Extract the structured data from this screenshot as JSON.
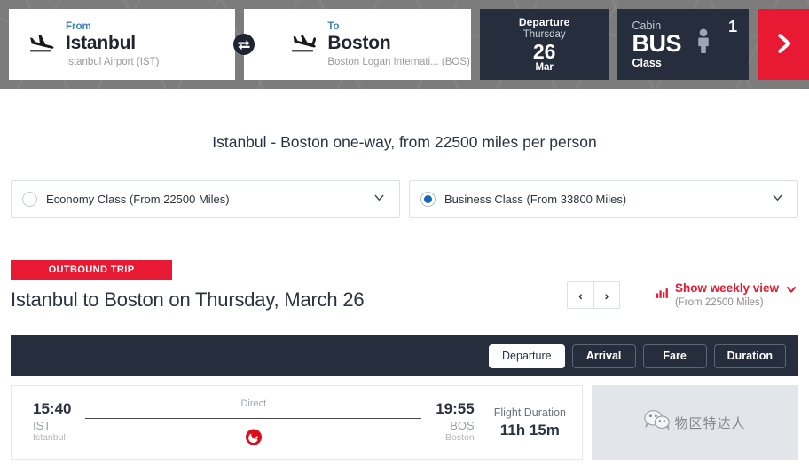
{
  "header": {
    "from": {
      "label": "From",
      "city": "Istanbul",
      "airport": "Istanbul Airport (IST)",
      "icon": "plane-departure-icon"
    },
    "to": {
      "label": "To",
      "city": "Boston",
      "airport": "Boston Logan Internati... (BOS)",
      "icon": "plane-arrival-icon"
    },
    "swap_icon": "swap-arrows-icon",
    "departure": {
      "title": "Departure",
      "weekday": "Thursday",
      "day": "26",
      "month": "Mar"
    },
    "cabin": {
      "label": "Cabin",
      "value": "BUS",
      "sub": "Class",
      "passenger_count": "1",
      "passenger_icon": "person-icon"
    },
    "go_button": {
      "icon": "chevron-right-icon",
      "color": "#e81932"
    }
  },
  "headline": "Istanbul - Boston one-way, from 22500 miles per person",
  "class_options": [
    {
      "label": "Economy Class (From 22500 Miles)",
      "selected": false,
      "chevron": "chevron-down-icon"
    },
    {
      "label": "Business Class (From 33800 Miles)",
      "selected": true,
      "chevron": "chevron-down-icon"
    }
  ],
  "trip": {
    "badge": "OUTBOUND TRIP",
    "title": "Istanbul to Boston on Thursday, March 26",
    "prev_label": "‹",
    "next_label": "›",
    "weekly_icon": "bar-chart-icon",
    "weekly_main": "Show weekly view",
    "weekly_sub": "(From 22500 Miles)",
    "weekly_chevron": "chevron-down-icon"
  },
  "sort_buttons": [
    {
      "label": "Departure",
      "active": true
    },
    {
      "label": "Arrival",
      "active": false
    },
    {
      "label": "Fare",
      "active": false
    },
    {
      "label": "Duration",
      "active": false
    }
  ],
  "flight": {
    "depart_time": "15:40",
    "depart_code": "IST",
    "depart_city": "Istanbul",
    "stops": "Direct",
    "airline_logo": "turkish-airlines-logo",
    "arrive_time": "19:55",
    "arrive_code": "BOS",
    "arrive_city": "Boston",
    "duration_label": "Flight Duration",
    "duration_value": "11h 15m"
  },
  "watermark": {
    "icon": "wechat-icon",
    "text": "物区特达人"
  },
  "colors": {
    "brand_red": "#e81932",
    "dark_navy": "#262e3d",
    "accent_blue": "#3d7fc1",
    "radio_blue": "#1767b5"
  }
}
